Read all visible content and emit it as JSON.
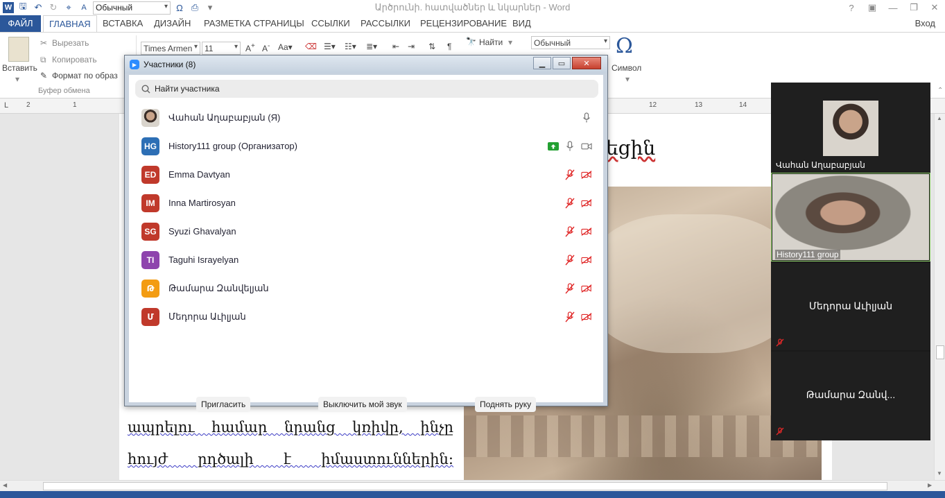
{
  "word": {
    "title": "Արծրունի. հատվածներ և նկարներ - Word",
    "quick_access": {
      "style_combo": "Обычный"
    },
    "tabs": [
      "ФАЙЛ",
      "ГЛАВНАЯ",
      "ВСТАВКА",
      "ДИЗАЙН",
      "РАЗМЕТКА СТРАНИЦЫ",
      "ССЫЛКИ",
      "РАССЫЛКИ",
      "РЕЦЕНЗИРОВАНИЕ",
      "ВИД"
    ],
    "active_tab": "ГЛАВНАЯ",
    "sign_in": "Вход",
    "ribbon": {
      "paste": "Вставить",
      "cut": "Вырезать",
      "copy": "Копировать",
      "format_painter": "Формат по образ",
      "clipboard_group": "Буфер обмена",
      "font_name": "Times Armen",
      "font_size": "11",
      "find": "Найти",
      "style": "Обычный",
      "symbol": "Символ"
    },
    "ruler_numbers": [
      "2",
      "1",
      "12",
      "13",
      "14"
    ],
    "document": {
      "heading_fragment": "եցին",
      "line1": "ապրելու համար նրանց կռիվը, ինչը",
      "line2": "հույժ րդծալի է իմաստուններին:"
    }
  },
  "participants": {
    "title": "Участники (8)",
    "search_placeholder": "Найти участника",
    "list": [
      {
        "initials": "",
        "name": "Վահան Աղաբաբյան (Я)",
        "color": "#8a6a50",
        "photo": true,
        "mic": "on",
        "video": "none",
        "share": false
      },
      {
        "initials": "HG",
        "name": "History111 group (Организатор)",
        "color": "#2d6fb5",
        "photo": false,
        "mic": "on",
        "video": "on",
        "share": true
      },
      {
        "initials": "ED",
        "name": "Emma Davtyan",
        "color": "#c0392b",
        "photo": false,
        "mic": "muted",
        "video": "off",
        "share": false
      },
      {
        "initials": "IM",
        "name": "Inna Martirosyan",
        "color": "#c0392b",
        "photo": false,
        "mic": "muted",
        "video": "off",
        "share": false
      },
      {
        "initials": "SG",
        "name": "Syuzi Ghavalyan",
        "color": "#c0392b",
        "photo": false,
        "mic": "muted",
        "video": "off",
        "share": false
      },
      {
        "initials": "TI",
        "name": "Taguhi Israyelyan",
        "color": "#8e44ad",
        "photo": false,
        "mic": "muted",
        "video": "off",
        "share": false
      },
      {
        "initials": "Թ",
        "name": "Թամարա Զանվելյան",
        "color": "#f39c12",
        "photo": false,
        "mic": "muted",
        "video": "off",
        "share": false
      },
      {
        "initials": "Մ",
        "name": "Մեդորա Աւիլյան",
        "color": "#c0392b",
        "photo": false,
        "mic": "muted",
        "video": "off",
        "share": false
      }
    ],
    "buttons": {
      "invite": "Пригласить",
      "mute_me": "Выключить мой звук",
      "raise_hand": "Поднять руку"
    }
  },
  "video_panel": {
    "tiles": [
      {
        "name": "Վահան Աղաբաբյան",
        "type": "photo"
      },
      {
        "name": "History111 group",
        "type": "video",
        "active_speaker": true
      },
      {
        "name": "Մեդորա Աւիլյան",
        "type": "name",
        "muted": true
      },
      {
        "name": "Թամարա Զանվ...",
        "type": "name",
        "muted": true
      }
    ]
  },
  "colors": {
    "word_blue": "#2b579a",
    "zoom_blue": "#2d8cff",
    "mute_red": "#e02828",
    "share_green": "#23a032",
    "active_speaker": "#8fd16a"
  }
}
